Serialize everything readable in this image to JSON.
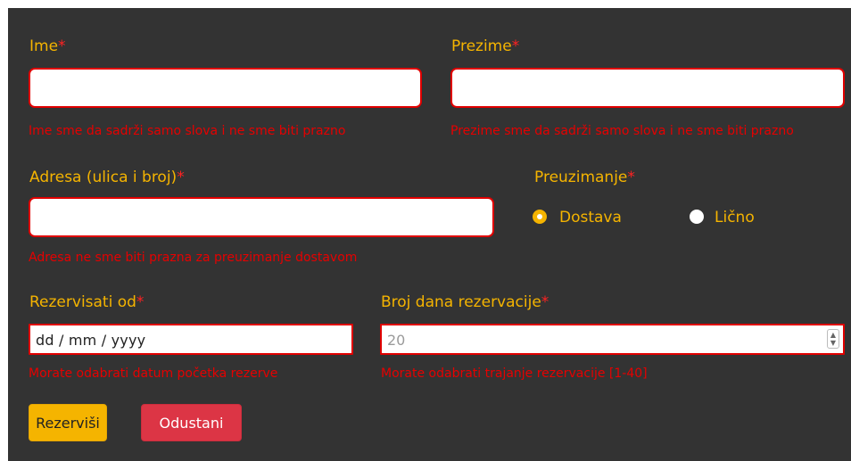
{
  "form": {
    "ime": {
      "label": "Ime",
      "required": "*",
      "value": "",
      "error": "Ime sme da sadrži samo slova i ne sme biti prazno"
    },
    "prezime": {
      "label": "Prezime",
      "required": "*",
      "value": "",
      "error": "Prezime sme da sadrži samo slova i ne sme biti prazno"
    },
    "adresa": {
      "label": "Adresa (ulica i broj)",
      "required": "*",
      "value": "",
      "error": "Adresa ne sme biti prazna za preuzimanje dostavom"
    },
    "preuzimanje": {
      "label": "Preuzimanje",
      "required": "*",
      "options": [
        {
          "label": "Dostava",
          "checked": true
        },
        {
          "label": "Lično",
          "checked": false
        }
      ]
    },
    "rezervisati_od": {
      "label": "Rezervisati od",
      "required": "*",
      "placeholder": "dd / mm / yyyy",
      "error": "Morate odabrati datum početka rezerve"
    },
    "broj_dana": {
      "label": "Broj dana rezervacije",
      "required": "*",
      "placeholder": "20",
      "error": "Morate odabrati trajanje rezervacije [1-40]"
    },
    "buttons": {
      "submit": "Rezerviši",
      "cancel": "Odustani"
    }
  },
  "colors": {
    "background": "#333333",
    "label": "#f5b400",
    "error": "#e60000",
    "submit": "#f5b400",
    "cancel": "#dc3545"
  },
  "icons": {
    "spinner": "number-spinner-icon",
    "radio_checked": "radio-checked-icon",
    "radio_unchecked": "radio-unchecked-icon"
  }
}
